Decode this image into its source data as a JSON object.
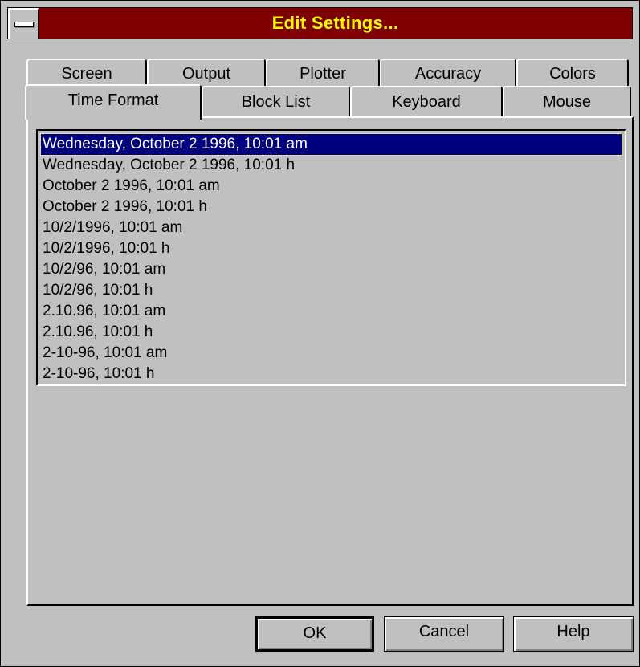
{
  "window": {
    "title": "Edit Settings..."
  },
  "tabs": {
    "row1": [
      "Screen",
      "Output",
      "Plotter",
      "Accuracy",
      "Colors"
    ],
    "row2": [
      "Time Format",
      "Block List",
      "Keyboard",
      "Mouse"
    ],
    "active": "Time Format"
  },
  "time_formats": {
    "items": [
      "Wednesday, October 2 1996, 10:01 am",
      "Wednesday, October 2 1996, 10:01 h",
      "October 2 1996, 10:01 am",
      "October 2 1996, 10:01 h",
      "10/2/1996, 10:01 am",
      "10/2/1996, 10:01 h",
      "10/2/96, 10:01 am",
      "10/2/96, 10:01 h",
      "2.10.96, 10:01 am",
      "2.10.96, 10:01 h",
      "2-10-96, 10:01 am",
      "2-10-96, 10:01 h"
    ],
    "selected_index": 0
  },
  "buttons": {
    "ok": "OK",
    "cancel": "Cancel",
    "help": "Help"
  },
  "colors": {
    "titlebar": "#800000",
    "title_text": "#ffff00",
    "selection": "#000080",
    "face": "#c0c0c0"
  }
}
